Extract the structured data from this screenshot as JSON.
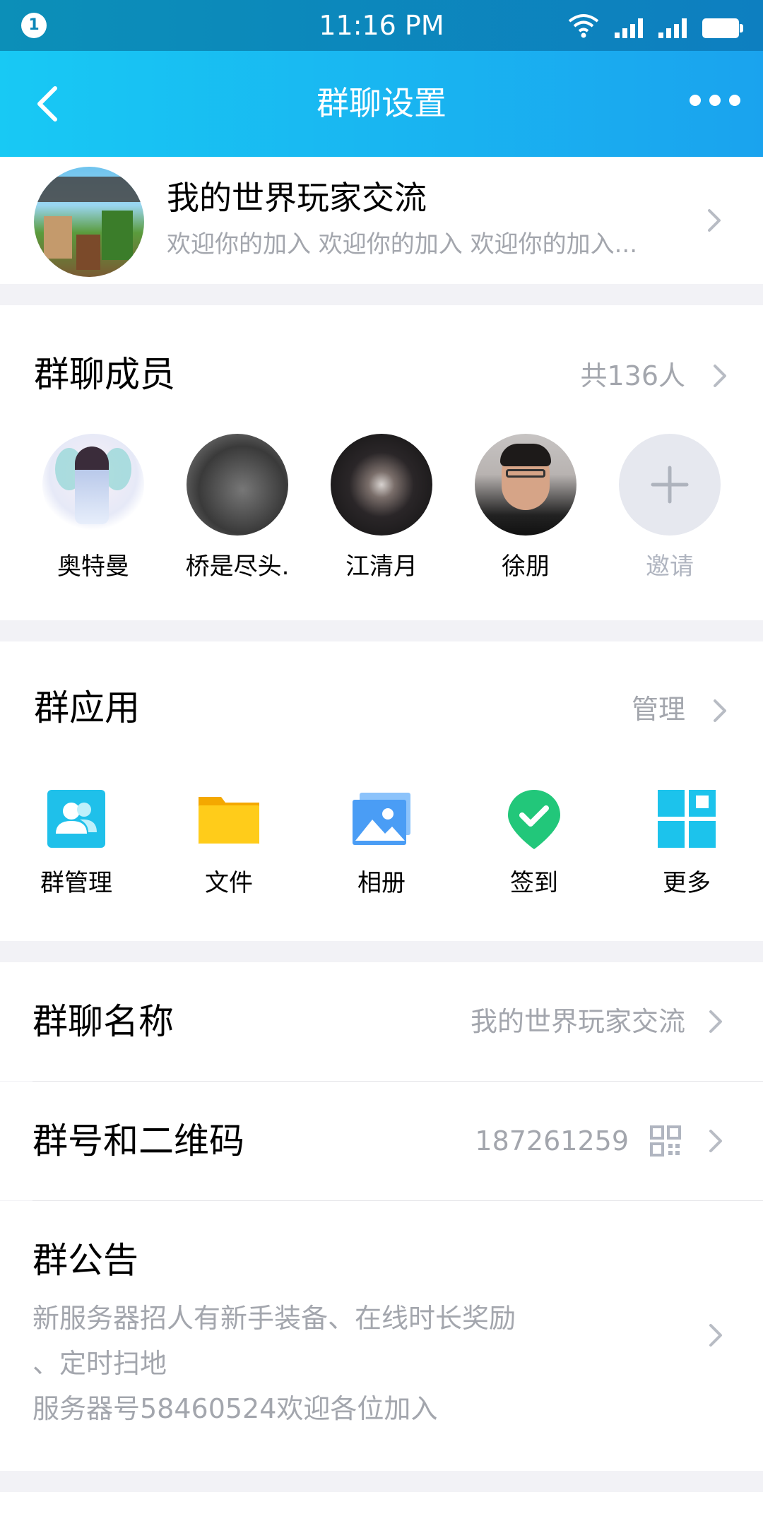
{
  "status_bar": {
    "notification_count": "1",
    "time": "11:16 PM"
  },
  "nav": {
    "title": "群聊设置"
  },
  "group": {
    "name": "我的世界玩家交流",
    "description": "欢迎你的加入  欢迎你的加入  欢迎你的加入..."
  },
  "members": {
    "title": "群聊成员",
    "count_label": "共136人",
    "items": [
      {
        "name": "奥特曼"
      },
      {
        "name": "桥是尽头."
      },
      {
        "name": "江清月"
      },
      {
        "name": "徐朋"
      }
    ],
    "invite_label": "邀请"
  },
  "apps": {
    "title": "群应用",
    "manage_label": "管理",
    "items": [
      {
        "label": "群管理",
        "icon": "group-manage-icon",
        "color": "#1fc0ea"
      },
      {
        "label": "文件",
        "icon": "folder-icon",
        "color": "#ffc20e"
      },
      {
        "label": "相册",
        "icon": "photo-album-icon",
        "color": "#4a9df5"
      },
      {
        "label": "签到",
        "icon": "checkin-icon",
        "color": "#22c77a"
      },
      {
        "label": "更多",
        "icon": "more-apps-icon",
        "color": "#1cc3ec"
      }
    ]
  },
  "settings": {
    "group_name_label": "群聊名称",
    "group_name_value": "我的世界玩家交流",
    "group_id_label": "群号和二维码",
    "group_id_value": "187261259",
    "notice_label": "群公告",
    "notice_line1": "新服务器招人有新手装备、在线时长奖励",
    "notice_line2": "、定时扫地",
    "notice_line3": "服务器号58460524欢迎各位加入"
  },
  "colors": {
    "nav_gradient_start": "#18c9f4",
    "nav_gradient_end": "#1aa3ee",
    "secondary_text": "#a3a6ad",
    "page_background": "#f2f2f6"
  }
}
